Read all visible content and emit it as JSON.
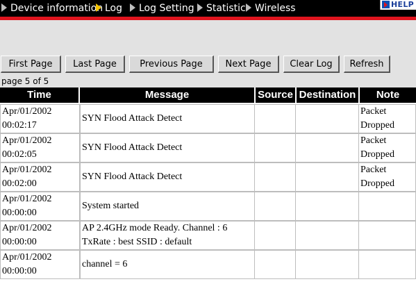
{
  "nav": {
    "items": [
      {
        "label": "Device information",
        "active": false
      },
      {
        "label": "Log",
        "active": true
      },
      {
        "label": "Log Setting",
        "active": false
      },
      {
        "label": "Statistic",
        "active": false
      },
      {
        "label": "Wireless",
        "active": false
      }
    ],
    "help_label": "HELP"
  },
  "buttons": {
    "first": "First Page",
    "last": "Last Page",
    "previous": "Previous Page",
    "next": "Next Page",
    "clear": "Clear Log",
    "refresh": "Refresh"
  },
  "page_info": "page 5 of 5",
  "table": {
    "headers": {
      "time": "Time",
      "message": "Message",
      "source": "Source",
      "destination": "Destination",
      "note": "Note"
    },
    "rows": [
      {
        "date": "Apr/01/2002",
        "clock": "00:02:17",
        "message": "SYN Flood Attack Detect",
        "source": "",
        "destination": "",
        "note": "Packet\nDropped"
      },
      {
        "date": "Apr/01/2002",
        "clock": "00:02:05",
        "message": "SYN Flood Attack Detect",
        "source": "",
        "destination": "",
        "note": "Packet\nDropped"
      },
      {
        "date": "Apr/01/2002",
        "clock": "00:02:00",
        "message": "SYN Flood Attack Detect",
        "source": "",
        "destination": "",
        "note": "Packet\nDropped"
      },
      {
        "date": "Apr/01/2002",
        "clock": "00:00:00",
        "message": "System started",
        "source": "",
        "destination": "",
        "note": ""
      },
      {
        "date": "Apr/01/2002",
        "clock": "00:00:00",
        "message": "AP 2.4GHz mode Ready. Channel : 6\nTxRate : best SSID : default",
        "source": "",
        "destination": "",
        "note": ""
      },
      {
        "date": "Apr/01/2002",
        "clock": "00:00:00",
        "message": "channel = 6",
        "source": "",
        "destination": "",
        "note": ""
      }
    ]
  },
  "colors": {
    "nav_bg": "#000000",
    "accent_red": "#e0141e",
    "active_arrow": "#f2c200",
    "page_bg": "#e2e2e2"
  }
}
